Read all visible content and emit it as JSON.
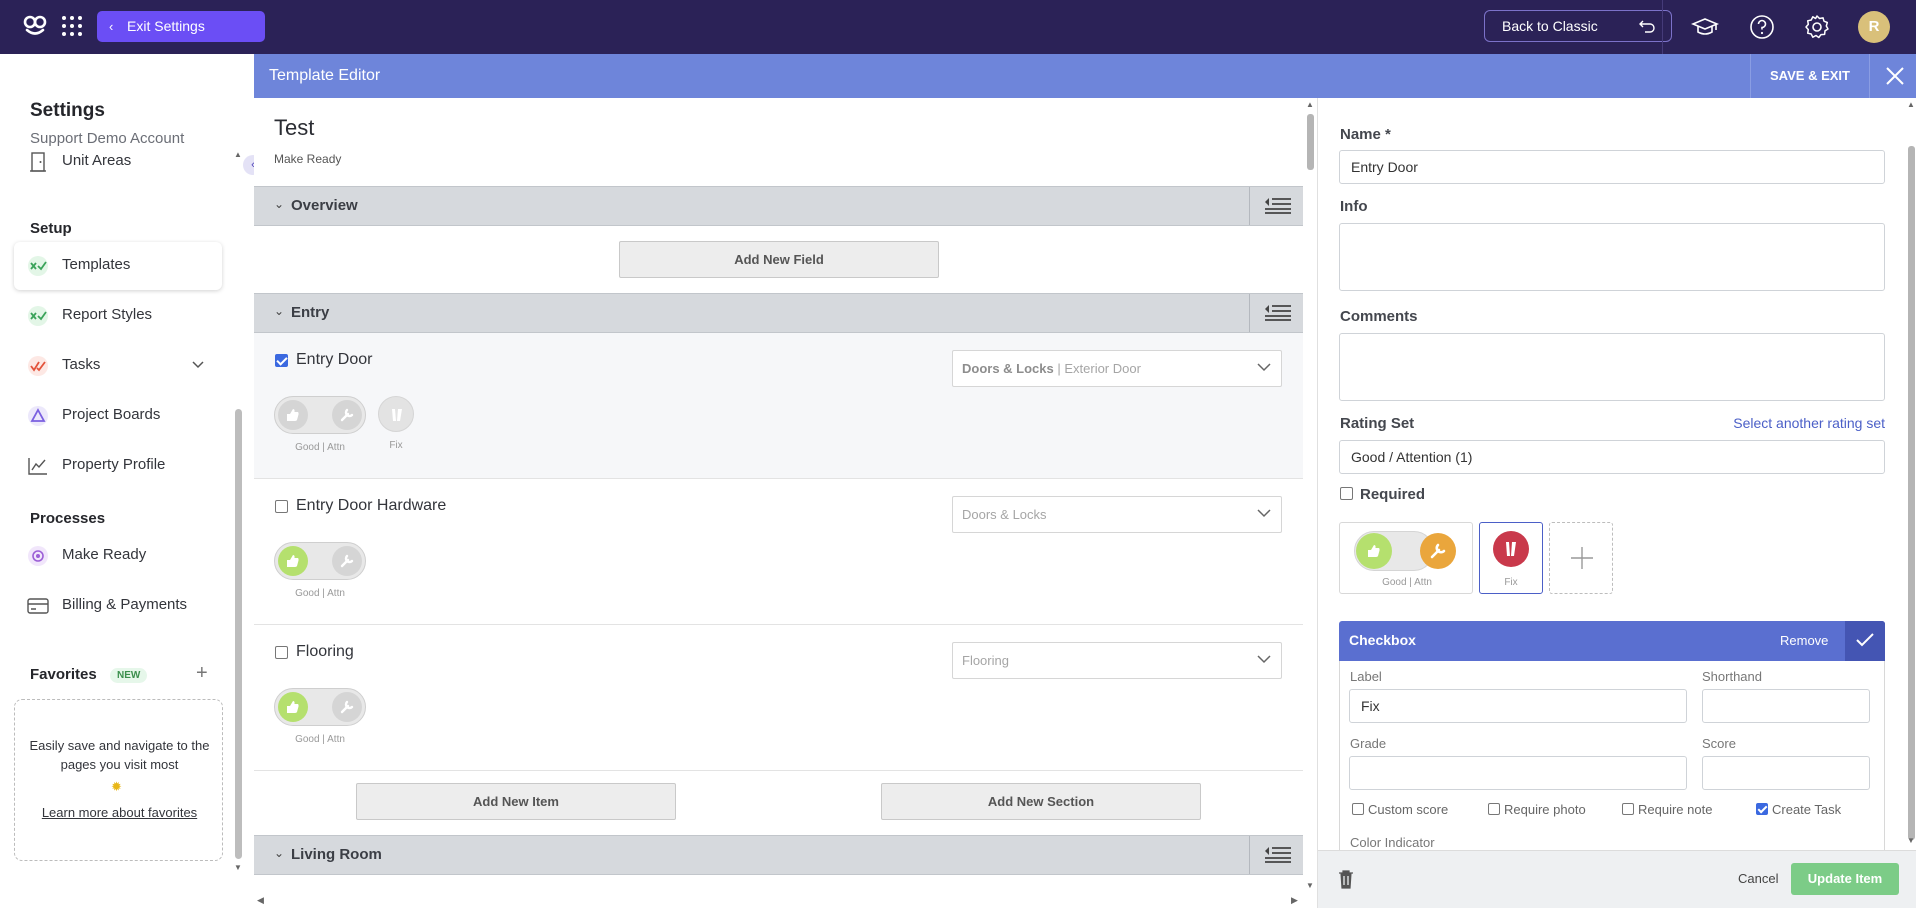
{
  "topbar": {
    "exit_settings": "Exit Settings",
    "back_to_classic": "Back to Classic",
    "avatar_initial": "R",
    "icons": [
      "graduation-cap-icon",
      "help-icon",
      "gear-icon"
    ]
  },
  "sidebar": {
    "title": "Settings",
    "account": "Support Demo Account",
    "items_top": [
      {
        "label": "Unit Areas",
        "icon": "door-icon"
      }
    ],
    "setup_heading": "Setup",
    "setup_items": [
      {
        "label": "Templates",
        "icon": "templates-icon",
        "active": true
      },
      {
        "label": "Report Styles",
        "icon": "report-styles-icon"
      },
      {
        "label": "Tasks",
        "icon": "tasks-icon"
      },
      {
        "label": "Project Boards",
        "icon": "project-boards-icon"
      },
      {
        "label": "Property Profile",
        "icon": "chart-line-icon"
      }
    ],
    "processes_heading": "Processes",
    "process_items": [
      {
        "label": "Make Ready",
        "icon": "make-ready-icon"
      },
      {
        "label": "Billing & Payments",
        "icon": "billing-icon"
      }
    ],
    "favorites_heading": "Favorites",
    "favorites_badge": "NEW",
    "favorites_text": "Easily save and navigate to the pages you visit most",
    "favorites_link": "Learn more about favorites"
  },
  "editor": {
    "title": "Template Editor",
    "save_exit": "SAVE & EXIT",
    "template_name": "Test",
    "template_type": "Make Ready",
    "sections": [
      {
        "label": "Overview"
      },
      {
        "label": "Entry"
      },
      {
        "label": "Living Room"
      }
    ],
    "add_new_field": "Add New Field",
    "add_new_item": "Add New Item",
    "add_new_section": "Add New Section",
    "items": [
      {
        "name": "Entry Door",
        "checked": true,
        "dropdown_bold": "Doors & Locks",
        "dropdown_rest": " | Exterior Door",
        "rating_label": "Good | Attn",
        "fix_label": "Fix"
      },
      {
        "name": "Entry Door Hardware",
        "checked": false,
        "dropdown_bold": "",
        "dropdown_rest": "Doors & Locks",
        "rating_label": "Good | Attn"
      },
      {
        "name": "Flooring",
        "checked": false,
        "dropdown_bold": "",
        "dropdown_rest": "Flooring",
        "rating_label": "Good | Attn"
      }
    ]
  },
  "panel": {
    "name_label": "Name *",
    "name_value": "Entry Door",
    "info_label": "Info",
    "comments_label": "Comments",
    "rating_set_label": "Rating Set",
    "select_rating_link": "Select another rating set",
    "rating_set_value": "Good / Attention (1)",
    "required_label": "Required",
    "rating_option_label": "Good | Attn",
    "fix_option_label": "Fix",
    "checkbox_title": "Checkbox",
    "remove": "Remove",
    "label_label": "Label",
    "label_value": "Fix",
    "shorthand_label": "Shorthand",
    "grade_label": "Grade",
    "score_label": "Score",
    "opts": [
      {
        "label": "Custom score",
        "checked": false
      },
      {
        "label": "Require photo",
        "checked": false
      },
      {
        "label": "Require note",
        "checked": false
      },
      {
        "label": "Create Task",
        "checked": true
      }
    ],
    "color_indicator": "Color Indicator",
    "cancel": "Cancel",
    "update_item": "Update Item"
  },
  "colors": {
    "topbar": "#2b2257",
    "accent": "#6b4ef5",
    "editor_header": "#6e85da",
    "good": "#b5e06e",
    "attn": "#eaa63c",
    "fix": "#c9394b"
  }
}
